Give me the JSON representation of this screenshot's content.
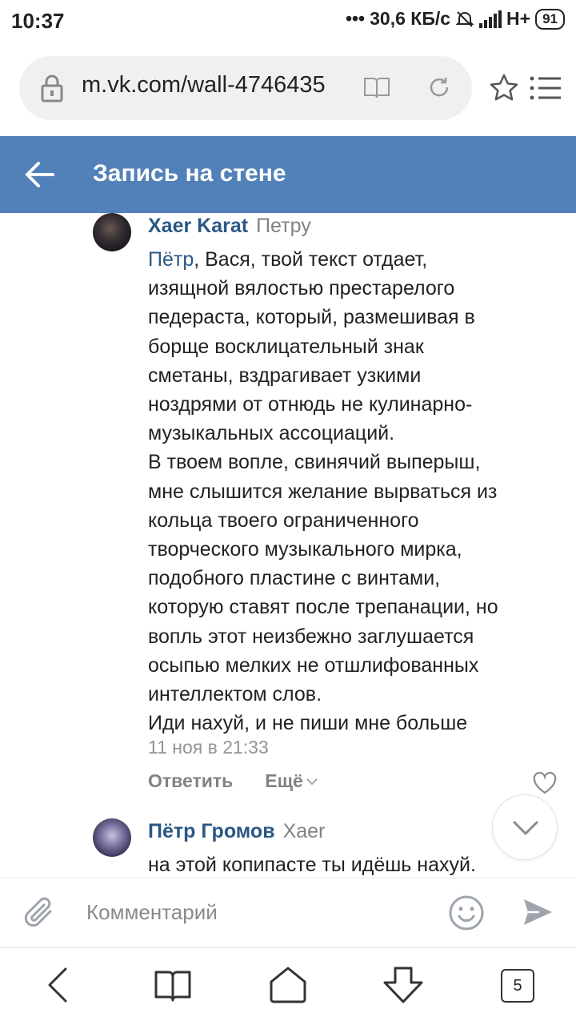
{
  "status_bar": {
    "time": "10:37",
    "speed": "30,6 КБ/с",
    "network": "H+",
    "battery": "91"
  },
  "browser": {
    "url": "m.vk.com/wall-4746435",
    "icons": [
      "lock-icon",
      "reader-icon",
      "reload-icon",
      "star-icon",
      "menu-icon"
    ]
  },
  "header": {
    "title": "Запись на стене",
    "color": "#5181b8"
  },
  "comments": [
    {
      "author": "Xaer Karat",
      "reply_to": "Петру",
      "mention": "Пётр",
      "text": ", Вася, твой текст отдает,\nизящной вялостью престарелого\nпедераста, который, размешивая в\nборще восклицательный знак\nсметаны, вздрагивает узкими\nноздрями от отнюдь не кулинарно-\nмузыкальных ассоциаций.\nВ твоем вопле, свинячий выперыш,\nмне слышится желание вырваться из\nкольца твоего ограниченного\nтворческого музыкального мирка,\nподобного пластине с винтами,\nкоторую ставят после трепанации, но\nвопль этот неизбежно заглушается\nосыпью мелких не отшлифованных\nинтеллектом слов.\nИди нахуй, и не пиши мне больше",
      "date": "11 ноя в 21:33",
      "reply_label": "Ответить",
      "more_label": "Ещё"
    },
    {
      "author": "Пётр Громов",
      "reply_to": "Xaer",
      "text": "на этой копипасте ты идёшь нахуй."
    }
  ],
  "composer": {
    "placeholder": "Комментарий"
  },
  "nav": {
    "tabs_count": "5"
  }
}
